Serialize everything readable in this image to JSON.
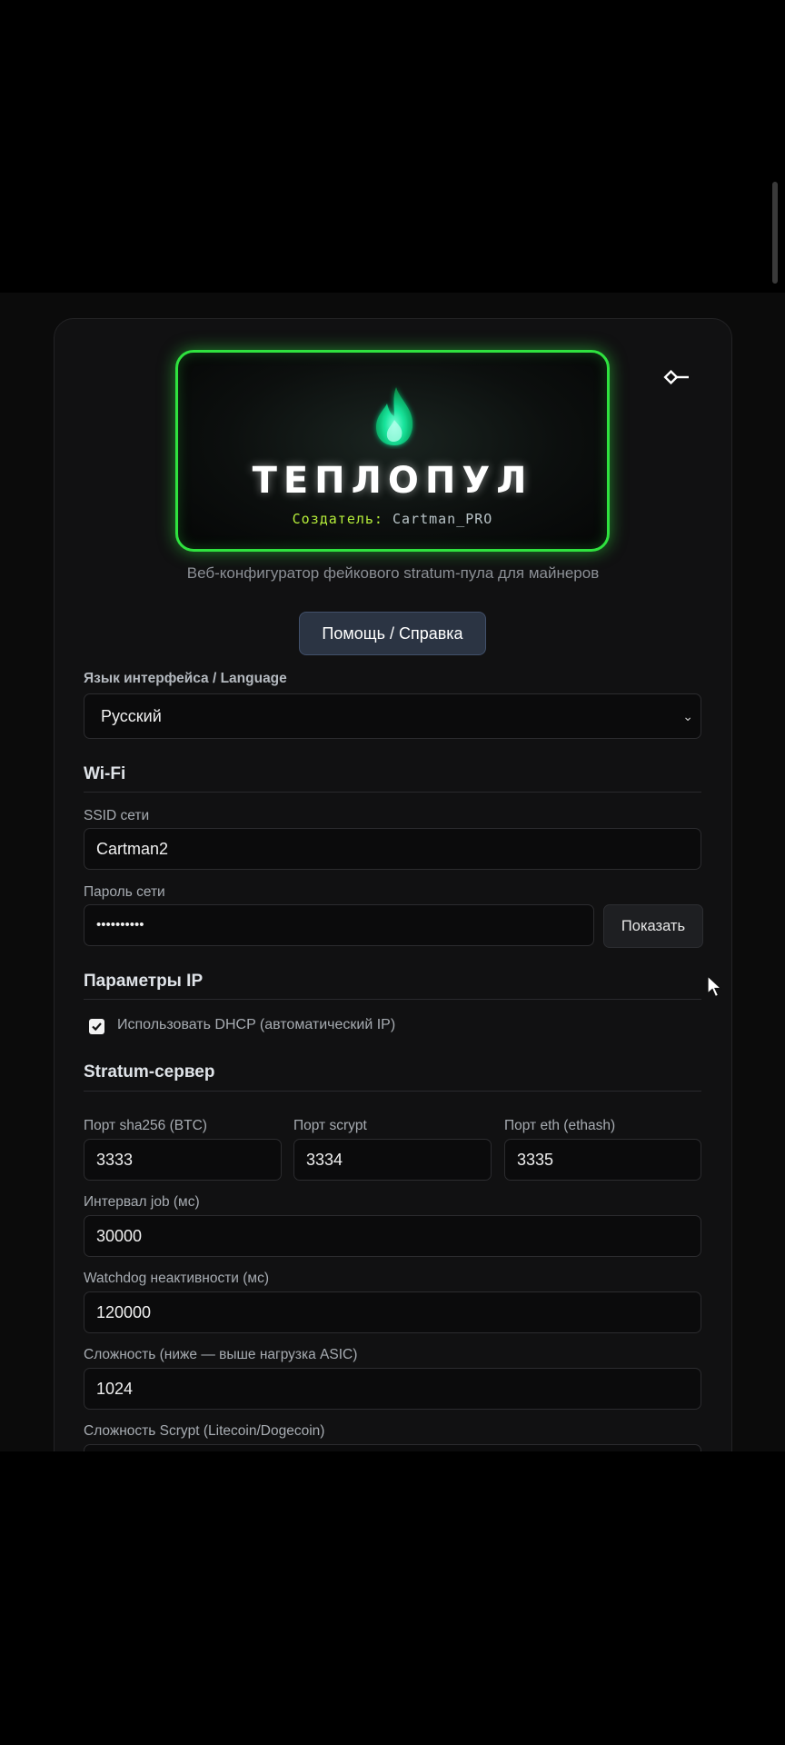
{
  "header": {
    "logo_title": "ТЕПЛОПУЛ",
    "creator_label": "Создатель:",
    "creator_name": "Cartman_PRO",
    "subtitle": "Веб-конфигуратор фейкового stratum-пула для майнеров",
    "help_button": "Помощь / Справка",
    "icons": {
      "logo": "flame-icon",
      "key": "key-icon"
    }
  },
  "language": {
    "label": "Язык интерфейса / Language",
    "selected": "Русский"
  },
  "wifi": {
    "title": "Wi-Fi",
    "ssid_label": "SSID сети",
    "ssid_value": "Cartman2",
    "password_label": "Пароль сети",
    "password_value": "••••••••••",
    "show_button": "Показать"
  },
  "ip": {
    "title": "Параметры IP",
    "dhcp_label": "Использовать DHCP (автоматический IP)",
    "dhcp_checked": true
  },
  "stratum": {
    "title": "Stratum-сервер",
    "ports": [
      {
        "label": "Порт sha256 (BTC)",
        "value": "3333"
      },
      {
        "label": "Порт scrypt",
        "value": "3334"
      },
      {
        "label": "Порт eth (ethash)",
        "value": "3335"
      }
    ],
    "job_interval_label": "Интервал job (мс)",
    "job_interval_value": "30000",
    "watchdog_label": "Watchdog неактивности (мс)",
    "watchdog_value": "120000",
    "difficulty_label": "Сложность (ниже — выше нагрузка ASIC)",
    "difficulty_value": "1024",
    "scrypt_difficulty_label": "Сложность Scrypt (Litecoin/Dogecoin)"
  },
  "colors": {
    "accent_green": "#2fe23f",
    "creator_label": "#b6ef3a",
    "help_button_bg": "#2b3443",
    "background": "#0b0b0b"
  }
}
